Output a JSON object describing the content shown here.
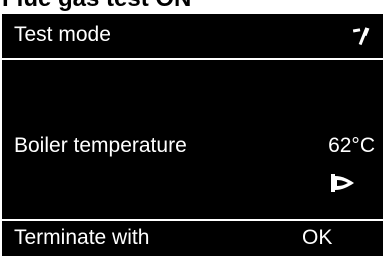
{
  "document": {
    "heading": "Flue gas test ON"
  },
  "screen": {
    "title": "Test mode",
    "title_icon": "wrench-icon",
    "reading": {
      "label": "Boiler temperature",
      "value": "62°C"
    },
    "status_icon": "flame-icon",
    "footer": {
      "prompt": "Terminate with",
      "ok_label": "OK"
    }
  },
  "colors": {
    "screen_background": "#000000",
    "screen_text": "#ffffff",
    "page_background": "#ffffff"
  }
}
